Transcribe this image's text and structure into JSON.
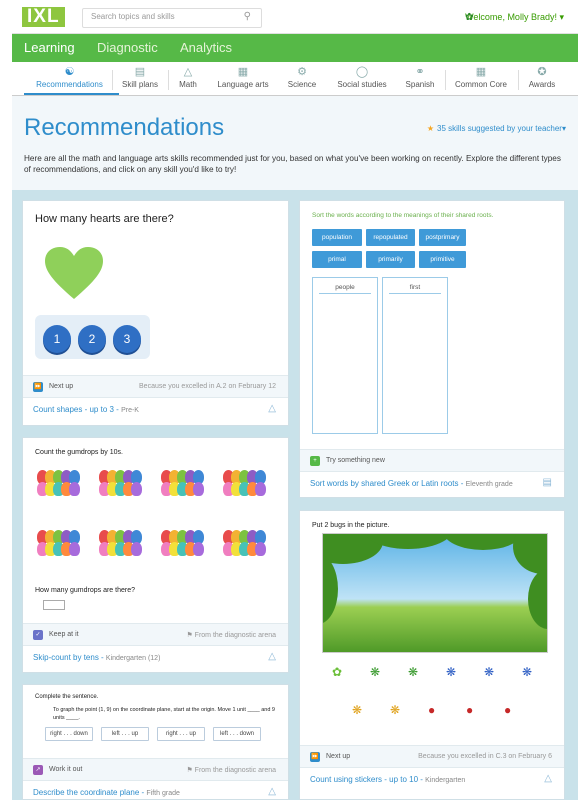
{
  "topbar": {
    "logo": "IXL",
    "search_placeholder": "Search topics and skills",
    "welcome": "Welcome, Molly Brady!"
  },
  "main_nav": [
    "Learning",
    "Diagnostic",
    "Analytics"
  ],
  "sub_nav": [
    {
      "label": "Recommendations",
      "icon": "recommendations-icon"
    },
    {
      "label": "Skill plans",
      "icon": "clipboard-icon"
    },
    {
      "label": "Math",
      "icon": "shapes-icon"
    },
    {
      "label": "Language arts",
      "icon": "books-icon"
    },
    {
      "label": "Science",
      "icon": "microscope-icon"
    },
    {
      "label": "Social studies",
      "icon": "globe-icon"
    },
    {
      "label": "Spanish",
      "icon": "speech-icon"
    },
    {
      "label": "Common Core",
      "icon": "document-icon"
    },
    {
      "label": "Awards",
      "icon": "star-icon"
    }
  ],
  "header": {
    "title": "Recommendations",
    "suggested": "35 skills suggested by your teacher",
    "description": "Here are all the math and language arts skills recommended just for you, based on what you've been working on recently. Explore the different types of recommendations, and click on any skill you'd like to try!"
  },
  "cards": {
    "hearts": {
      "question": "How many hearts are there?",
      "choices": [
        "1",
        "2",
        "3"
      ],
      "tag": "Next up",
      "reason": "Because you excelled in A.2 on February 12",
      "skill": "Count shapes - up to 3",
      "grade": "Pre-K"
    },
    "gumdrops": {
      "instruction": "Count the gumdrops by 10s.",
      "question": "How many gumdrops are there?",
      "tag": "Keep at it",
      "reason": "From the diagnostic arena",
      "skill": "Skip-count by tens",
      "grade": "Kindergarten (12)"
    },
    "coordinate": {
      "instruction": "Complete the sentence.",
      "prompt": "To graph the point (1, 9) on the coordinate plane, start at the origin. Move 1 unit ____ and 9 units ____.",
      "options": [
        "right . . . down",
        "left . . . up",
        "right . . . up",
        "left . . . down"
      ],
      "tag": "Work it out",
      "reason": "From the diagnostic arena",
      "skill": "Describe the coordinate plane",
      "grade": "Fifth grade"
    },
    "roots": {
      "instruction": "Sort the words according to the meanings of their shared roots.",
      "words": [
        "population",
        "repopulated",
        "postprimary",
        "primal",
        "primarily",
        "primitive"
      ],
      "columns": [
        "people",
        "first"
      ],
      "tag": "Try something new",
      "skill": "Sort words by shared Greek or Latin roots",
      "grade": "Eleventh grade"
    },
    "bugs": {
      "instruction": "Put 2 bugs in the picture.",
      "tag": "Next up",
      "reason": "Because you excelled in C.3 on February 6",
      "skill": "Count using stickers - up to 10",
      "grade": "Kindergarten"
    }
  },
  "colors": {
    "green": "#56b947",
    "blue": "#2f8dcb",
    "background": "#c9e2ea"
  }
}
